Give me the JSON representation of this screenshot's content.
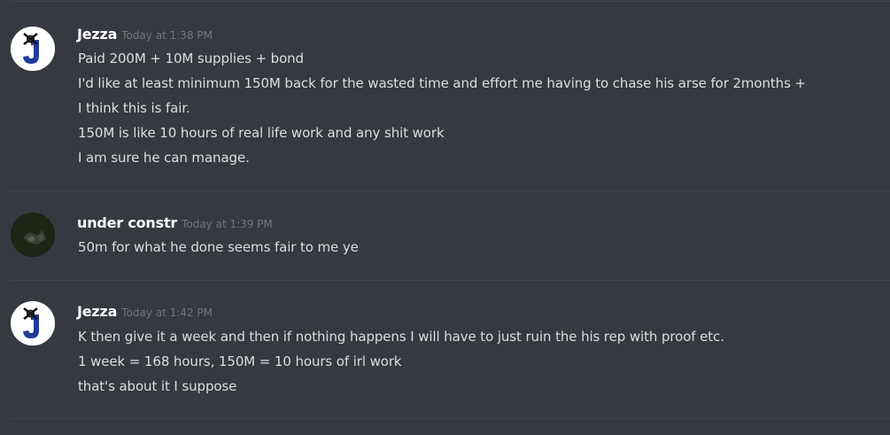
{
  "messages": [
    {
      "username": "Jezza",
      "timestamp": "Today at 1:38 PM",
      "avatar_icon": "jezza-avatar-icon",
      "lines": [
        "Paid 200M + 10M supplies + bond",
        "I'd like at least minimum 150M back for the wasted time and effort me having to chase his arse for 2months +",
        "I think this is fair.",
        "150M is like 10 hours of real life work and any shit work",
        "I am sure he can manage."
      ]
    },
    {
      "username": "under constr",
      "timestamp": "Today at 1:39 PM",
      "avatar_icon": "under-constr-avatar-icon",
      "lines": [
        "50m for what he done seems fair to me ye"
      ]
    },
    {
      "username": "Jezza",
      "timestamp": "Today at 1:42 PM",
      "avatar_icon": "jezza-avatar-icon",
      "lines": [
        "K then give it a week and then if nothing happens I will have to just ruin the his rep with proof etc.",
        "1 week = 168 hours, 150M = 10 hours of irl work",
        "that's about it I suppose"
      ]
    }
  ],
  "colors": {
    "background": "#36393f",
    "username": "#ffffff",
    "message_text": "#dcddde",
    "timestamp": "#72767d",
    "divider": "#42454a",
    "jezza_avatar_letter": "#1f3c99"
  }
}
